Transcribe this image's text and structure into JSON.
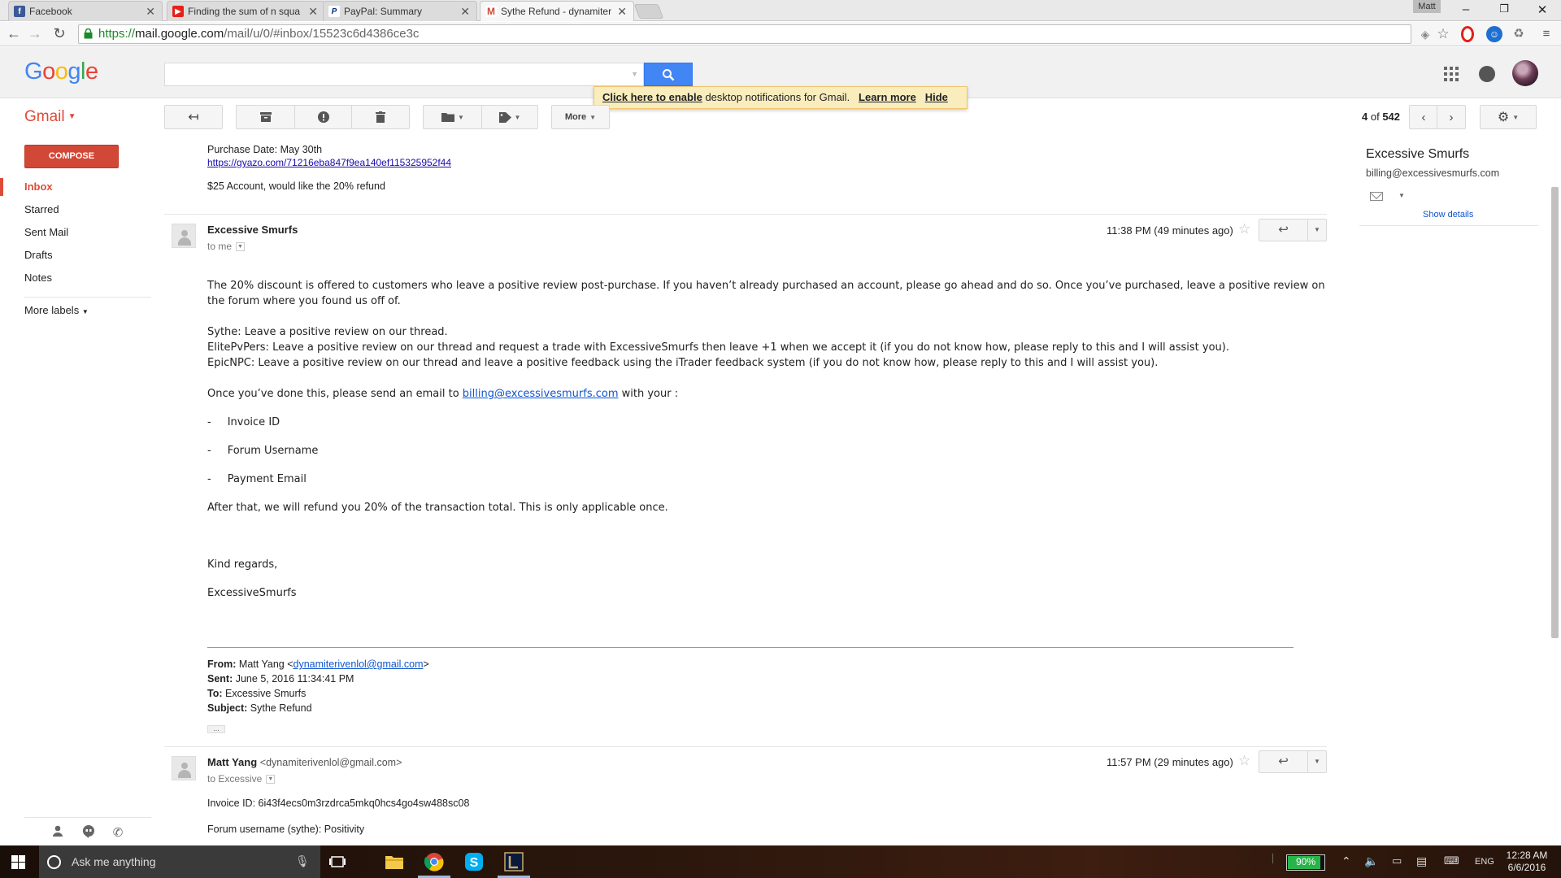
{
  "browser": {
    "tabs": [
      {
        "title": "Facebook",
        "favicon": "facebook-icon",
        "color": "#3b5998"
      },
      {
        "title": "Finding the sum of n squa",
        "favicon": "youtube-icon",
        "color": "#e62117"
      },
      {
        "title": "PayPal: Summary",
        "favicon": "paypal-icon",
        "color": "#003087"
      },
      {
        "title": "Sythe Refund - dynamiter",
        "favicon": "gmail-icon",
        "color": "#d14836"
      }
    ],
    "profile": "Matt",
    "url": {
      "scheme": "https://",
      "host": "mail.google.com",
      "path": "/mail/u/0/#inbox/15523c6d4386ce3c"
    }
  },
  "google": {
    "logo": "Google",
    "notification": {
      "link": "Click here to enable",
      "text": " desktop notifications for Gmail.",
      "learn_more": "Learn more",
      "hide": "Hide"
    }
  },
  "gmail": {
    "label": "Gmail",
    "toolbar": {
      "more": "More"
    },
    "counter": {
      "current": "4",
      "of": "of",
      "total": "542"
    },
    "compose": "COMPOSE",
    "nav": {
      "inbox": "Inbox",
      "starred": "Starred",
      "sent": "Sent Mail",
      "drafts": "Drafts",
      "notes": "Notes",
      "more_labels": "More labels"
    }
  },
  "thread": {
    "prev_quote": {
      "purchase_date": "Purchase Date: May 30th",
      "link": "https://gyazo.com/71216eba847f9ea140ef115325952f44",
      "note": "$25 Account, would like the 20% refund"
    },
    "message1": {
      "sender": "Excessive Smurfs",
      "to": "to me",
      "time": "11:38 PM (49 minutes ago)",
      "p1": "The 20% discount is offered to customers who leave a positive review post-purchase. If you haven’t already purchased an account, please go ahead and do so. Once you’ve purchased, leave a positive review on",
      "p1b": "the forum where you found us off of.",
      "sythe": "Sythe: Leave a positive review on our thread.",
      "elite": "ElitePvPers: Leave a positive review on our thread and request a trade with ExcessiveSmurfs then leave +1 when we accept it (if you do not know how, please reply to this and I will assist you).",
      "epic": "EpicNPC: Leave a positive review on our thread and leave a positive feedback using the iTrader feedback system (if you do not know how, please reply to this and I will assist you).",
      "send_pre": "Once you’ve done this, please send an email to ",
      "send_link": "billing@excessivesmurfs.com",
      "send_post": " with your :",
      "item1": "Invoice ID",
      "item2": "Forum Username",
      "item3": "Payment Email",
      "after": "After that, we will refund you 20% of the transaction total. This is only applicable once.",
      "regards": "Kind regards,",
      "signature": "ExcessiveSmurfs",
      "quoted": {
        "from_label": "From:",
        "from_name": "Matt Yang <",
        "from_email": "dynamiterivenlol@gmail.com",
        "from_close": ">",
        "sent_label": "Sent:",
        "sent": "June 5, 2016 11:34:41 PM",
        "to_label": "To:",
        "to": "Excessive Smurfs",
        "subject_label": "Subject:",
        "subject": "Sythe Refund"
      }
    },
    "message2": {
      "sender": "Matt Yang",
      "address": "<dynamiterivenlol@gmail.com>",
      "to": "to Excessive",
      "time": "11:57 PM (29 minutes ago)",
      "invoice": "Invoice ID: 6i43f4ecs0m3rzdrca5mkq0hcs4go4sw488sc08",
      "forum": "Forum username (sythe): Positivity"
    }
  },
  "contact_panel": {
    "name": "Excessive Smurfs",
    "email": "billing@excessivesmurfs.com",
    "show_details": "Show details"
  },
  "taskbar": {
    "search_placeholder": "Ask me anything",
    "battery": "90%",
    "battery_level": 0.9,
    "language": "ENG",
    "time": "12:28 AM",
    "date": "6/6/2016"
  }
}
